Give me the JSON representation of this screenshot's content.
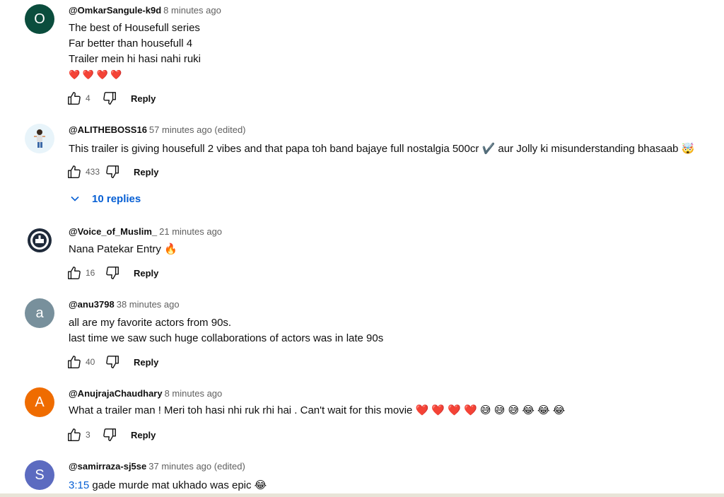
{
  "comments": [
    {
      "author": "@OmkarSangule-k9d",
      "time": "8 minutes ago",
      "avatar_letter": "O",
      "avatar_color": "#0b4d3d",
      "lines": [
        "The best of Housefull series",
        "Far better than housefull 4",
        "Trailer mein hi hasi nahi ruki",
        "❤️ ❤️ ❤️ ❤️"
      ],
      "likes": "4",
      "reply_label": "Reply"
    },
    {
      "author": "@ALITHEBOSS16",
      "time": "57 minutes ago (edited)",
      "avatar_icon": "person-avatar-icon",
      "lines": [
        "This trailer is giving housefull 2 vibes and that papa toh band bajaye full nostalgia 500cr ✔️  aur Jolly ki misunderstanding bhasaab 🤯"
      ],
      "likes": "433",
      "reply_label": "Reply",
      "replies_label": "10 replies"
    },
    {
      "author": "@Voice_of_Muslim_",
      "time": "21 minutes ago",
      "avatar_icon": "logo-avatar-icon",
      "lines": [
        "Nana Patekar Entry 🔥"
      ],
      "likes": "16",
      "reply_label": "Reply"
    },
    {
      "author": "@anu3798",
      "time": "38 minutes ago",
      "avatar_letter": "a",
      "avatar_color": "#78909c",
      "lines": [
        "all are my favorite actors from 90s.",
        "last time we saw such huge collaborations of actors was in late 90s"
      ],
      "likes": "40",
      "reply_label": "Reply"
    },
    {
      "author": "@AnujrajaChaudhary",
      "time": "8 minutes ago",
      "avatar_letter": "A",
      "avatar_color": "#ef6c00",
      "lines": [
        "What a trailer man ! Meri toh hasi nhi ruk rhi hai . Can't wait for this movie ❤️ ❤️ ❤️ ❤️ 😅 😅 😅 😂 😂 😂"
      ],
      "likes": "3",
      "reply_label": "Reply"
    },
    {
      "author": "@samirraza-sj5se",
      "time": "37 minutes ago (edited)",
      "avatar_letter": "S",
      "avatar_color": "#5c6bc0",
      "timestamp_link": "3:15",
      "lines": [
        " gade murde mat ukhado was epic 😂"
      ]
    }
  ]
}
